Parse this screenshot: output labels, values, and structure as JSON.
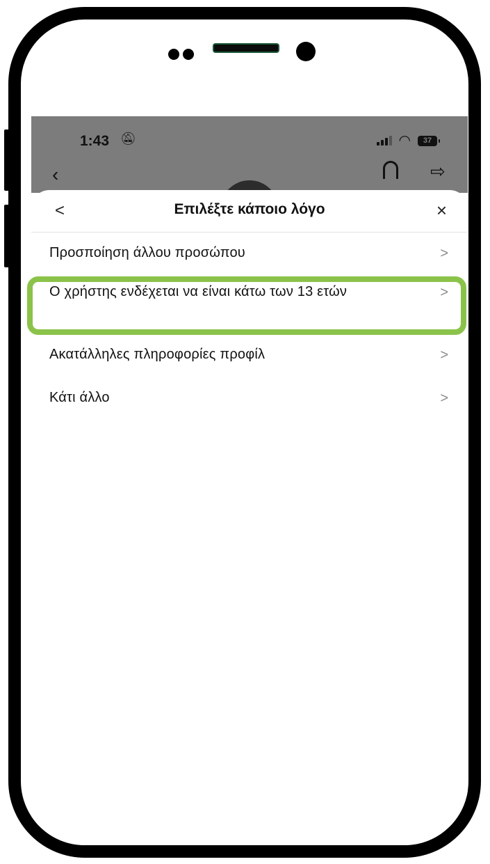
{
  "status_bar": {
    "time": "1:43",
    "battery": "37"
  },
  "sheet": {
    "title": "Επιλέξτε κάποιο λόγο",
    "back_icon": "chevron-left-icon",
    "close_icon": "close-icon"
  },
  "reasons": [
    {
      "label": "Προσποίηση άλλου προσώπου"
    },
    {
      "label": "Ο χρήστης ενδέχεται να είναι κάτω των 13 ετών"
    },
    {
      "label": "Ακατάλληλες πληροφορίες προφίλ"
    },
    {
      "label": "Κάτι άλλο"
    }
  ],
  "highlight_color": "#8bc34a"
}
